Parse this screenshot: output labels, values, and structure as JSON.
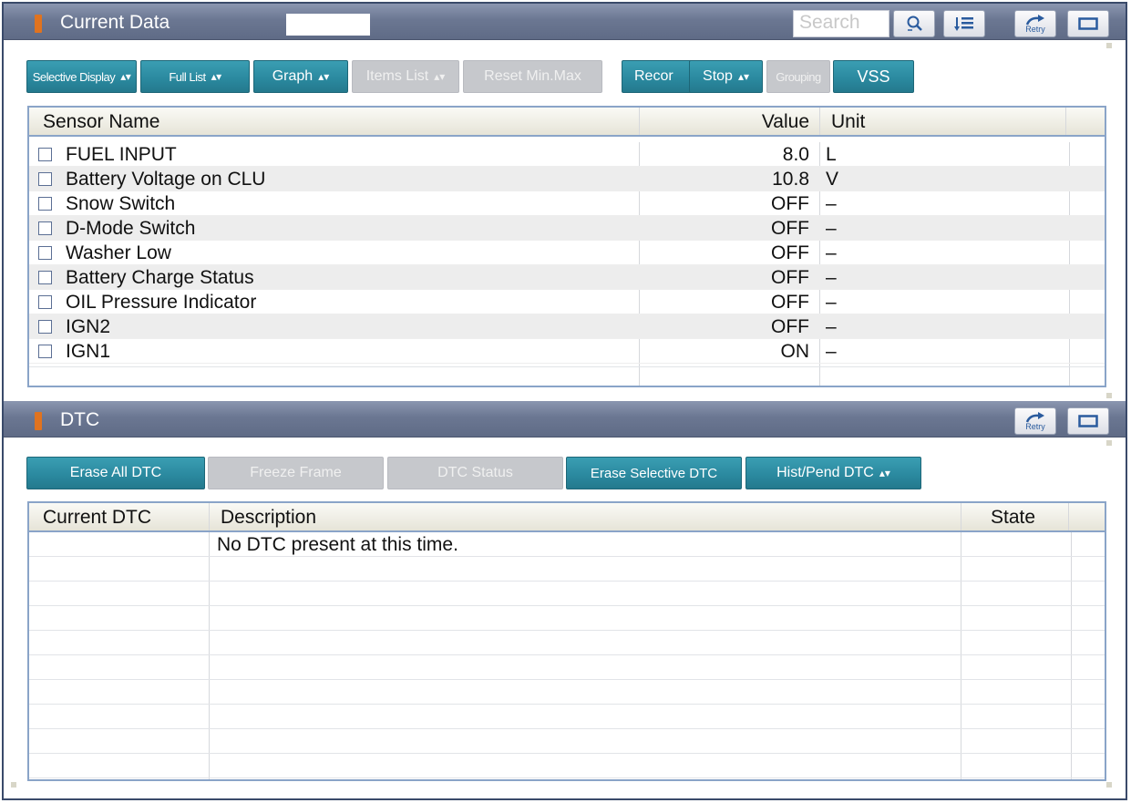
{
  "current_data": {
    "title": "Current Data",
    "search_placeholder": "Search",
    "retry_label": "Retry",
    "buttons": [
      {
        "label": "Selective Display",
        "has_arrows": true,
        "style": "teal"
      },
      {
        "label": "Full List",
        "has_arrows": true,
        "style": "teal"
      },
      {
        "label": "Graph",
        "has_arrows": true,
        "style": "teal"
      },
      {
        "label": "Items List",
        "has_arrows": true,
        "style": "gray"
      },
      {
        "label": "Reset Min.Max",
        "has_arrows": false,
        "style": "gray"
      },
      {
        "label": "Recor",
        "has_arrows": false,
        "style": "teal"
      },
      {
        "label": "Stop",
        "has_arrows": true,
        "style": "teal"
      },
      {
        "label": "Grouping",
        "has_arrows": false,
        "style": "gray"
      },
      {
        "label": "VSS",
        "has_arrows": false,
        "style": "teal"
      }
    ],
    "columns": {
      "sensor": "Sensor Name",
      "value": "Value",
      "unit": "Unit"
    },
    "rows": [
      {
        "name": "FUEL INPUT",
        "value": "8.0",
        "unit": "L"
      },
      {
        "name": "Battery Voltage on CLU",
        "value": "10.8",
        "unit": "V"
      },
      {
        "name": "Snow Switch",
        "value": "OFF",
        "unit": "–"
      },
      {
        "name": "D-Mode Switch",
        "value": "OFF",
        "unit": "–"
      },
      {
        "name": "Washer Low",
        "value": "OFF",
        "unit": "–"
      },
      {
        "name": "Battery Charge Status",
        "value": "OFF",
        "unit": "–"
      },
      {
        "name": "OIL Pressure Indicator",
        "value": "OFF",
        "unit": "–"
      },
      {
        "name": "IGN2",
        "value": "OFF",
        "unit": "–"
      },
      {
        "name": "IGN1",
        "value": "ON",
        "unit": "–"
      }
    ]
  },
  "dtc": {
    "title": "DTC",
    "retry_label": "Retry",
    "buttons": [
      {
        "label": "Erase All DTC",
        "has_arrows": false,
        "style": "teal"
      },
      {
        "label": "Freeze Frame",
        "has_arrows": false,
        "style": "gray"
      },
      {
        "label": "DTC Status",
        "has_arrows": false,
        "style": "gray"
      },
      {
        "label": "Erase Selective DTC",
        "has_arrows": false,
        "style": "teal"
      },
      {
        "label": "Hist/Pend DTC",
        "has_arrows": true,
        "style": "teal"
      }
    ],
    "columns": {
      "code": "Current DTC",
      "description": "Description",
      "state": "State"
    },
    "message": "No DTC present at this time."
  }
}
